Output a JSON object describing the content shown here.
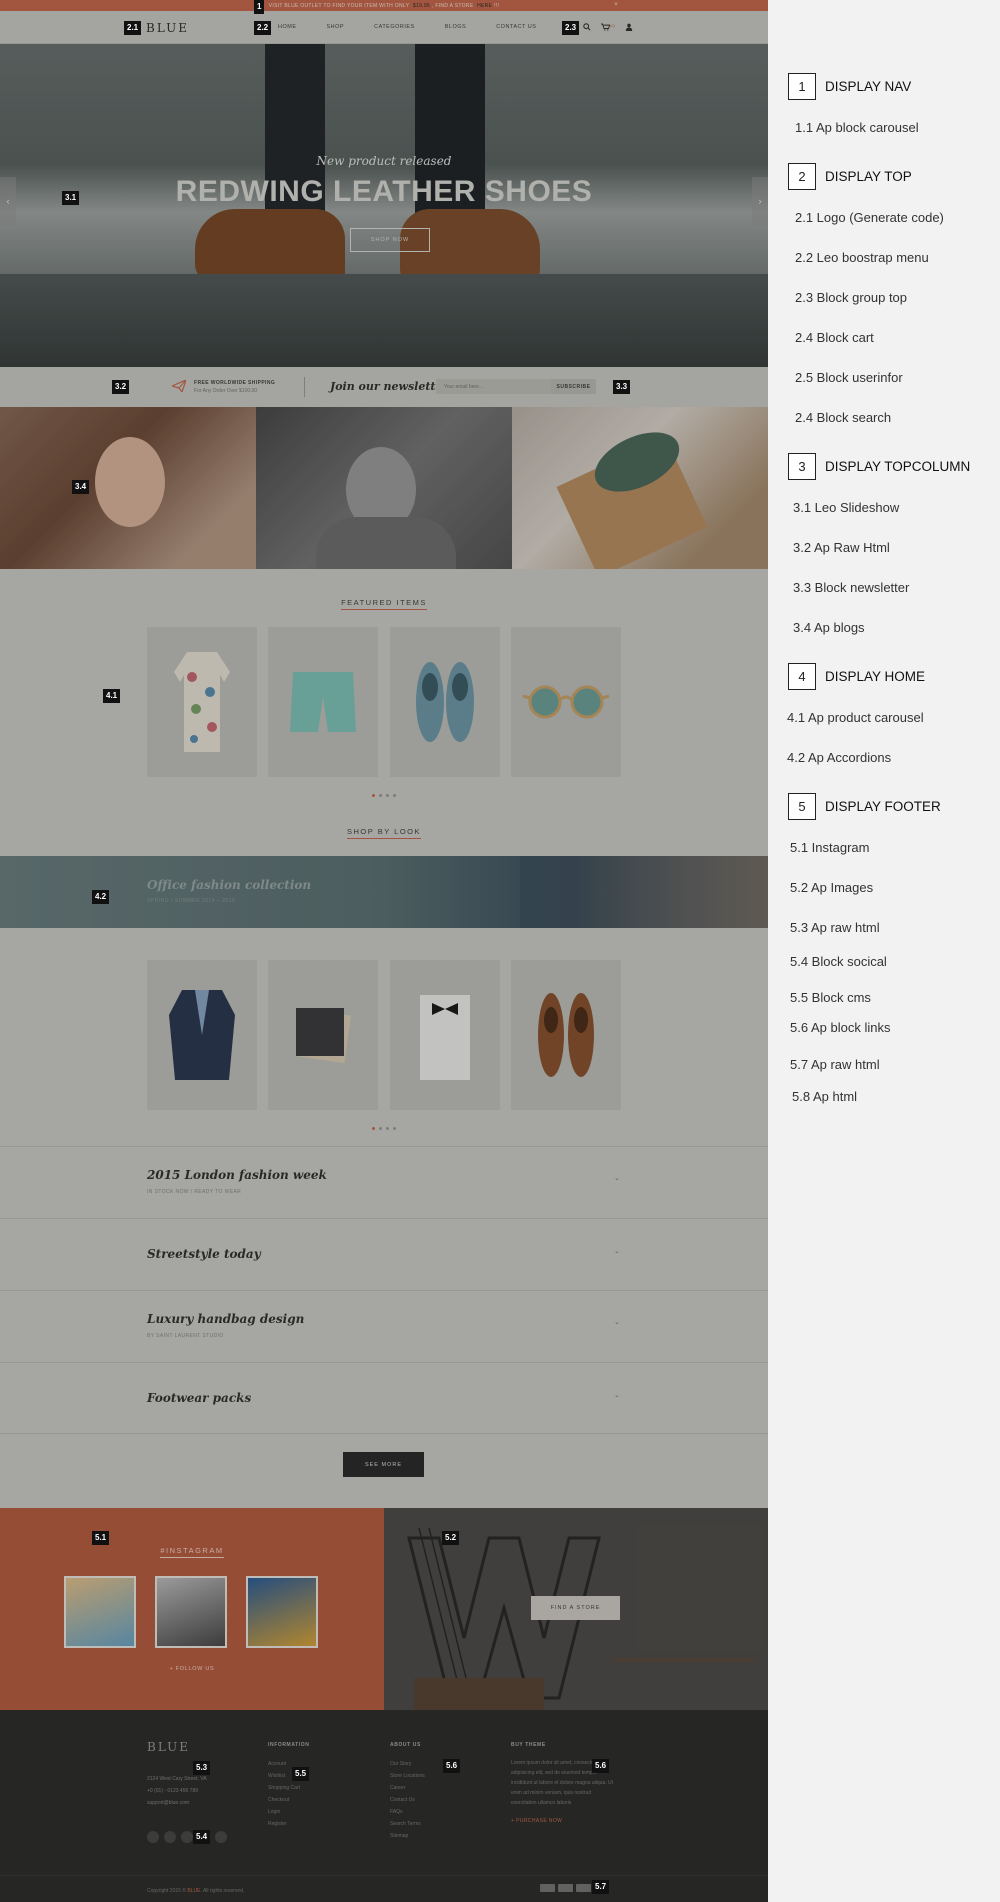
{
  "topbar": {
    "text_before": "VISIT BLUE OUTLET TO FIND YOUR ITEM WITH ONLY",
    "price": "$19.95",
    "text_mid": ", FIND A STORE",
    "link": "HERE",
    "text_after": "!!!",
    "close": "×"
  },
  "header": {
    "logo": "BLUE",
    "menu": [
      "HOME",
      "SHOP",
      "CATEGORIES",
      "BLOGS",
      "CONTACT US"
    ],
    "icons": [
      "search-icon",
      "cart-icon",
      "user-icon"
    ],
    "cart_count": "(0)"
  },
  "hero": {
    "subtitle": "New product released",
    "title": "REDWING LEATHER SHOES",
    "button": "SHOP NOW",
    "prev": "‹",
    "next": "›"
  },
  "shipping": {
    "title": "FREE WORLDWIDE SHIPPING",
    "subtitle": "For Any Order Over $100.00"
  },
  "newsletter": {
    "title": "Join our newsletters",
    "placeholder": "Your email here...",
    "button": "SUBSCRIBE"
  },
  "featured": {
    "title": "FEATURED ITEMS",
    "products": [
      "floral-shirt",
      "mint-shorts",
      "blue-loafers",
      "sunglasses"
    ]
  },
  "shop_by_look": {
    "title": "SHOP BY LOOK",
    "banner_title": "Office fashion collection",
    "banner_sub": "SPRING / SUMMER 2014 – 2015",
    "products": [
      "navy-blazer",
      "pocket-square",
      "white-shirt-bowtie",
      "brown-oxford-shoes"
    ]
  },
  "accordions": [
    {
      "title": "2015 London fashion week",
      "sub": "IN STOCK NOW / READY TO WEAR"
    },
    {
      "title": "Streetstyle today",
      "sub": ""
    },
    {
      "title": "Luxury handbag design",
      "sub": "BY SAINT LAURENT STUDIO"
    },
    {
      "title": "Footwear packs",
      "sub": ""
    }
  ],
  "see_more": "SEE MORE",
  "instagram": {
    "title": "#INSTAGRAM",
    "follow": "+ FOLLOW US"
  },
  "store_button": "FIND A STORE",
  "footer": {
    "logo": "BLUE",
    "address": [
      "2124 West Cary Street, VA",
      "+0 (01) - 0123 456 789",
      "support@blue.com"
    ],
    "information": {
      "title": "INFORMATION",
      "items": [
        "Account",
        "Wishlist",
        "Shopping Cart",
        "Checkout",
        "Login",
        "Register"
      ]
    },
    "about": {
      "title": "ABOUT US",
      "items": [
        "Our Story",
        "Store Locations",
        "Career",
        "Contact Us",
        "FAQs",
        "Search Terms",
        "Sitemap"
      ]
    },
    "buy": {
      "title": "BUY THEME",
      "text": "Lorem ipsum dolor sit amet, consectetur adipisicing elit, sed do eiusmod tempor incididunt ut labore et dolore magna aliqua. Ut enim ad minim veniam, quis nostrud exercitation ullamco laboris",
      "link": "+ PURCHASE NOW"
    },
    "copyright_before": "Copyright 2015 ©",
    "copyright_brand": "BLUE",
    "copyright_after": ". All rights reserved."
  },
  "badges": [
    "1",
    "2.1",
    "2.2",
    "2.3",
    "3.1",
    "3.2",
    "3.3",
    "3.4",
    "4.1",
    "4.2",
    "5.1",
    "5.2",
    "5.3",
    "5.4",
    "5.5",
    "5.6",
    "5.6",
    "5.7"
  ],
  "legend": {
    "sections": [
      {
        "num": "1",
        "title": "DISPLAY NAV",
        "items": [
          "1.1  Ap block carousel"
        ]
      },
      {
        "num": "2",
        "title": "DISPLAY TOP",
        "items": [
          "2.1 Logo (Generate code)",
          "2.2 Leo boostrap menu",
          "2.3 Block group top",
          "2.4 Block cart",
          "2.5 Block userinfor",
          "2.4 Block search"
        ]
      },
      {
        "num": "3",
        "title": "DISPLAY TOPCOLUMN",
        "items": [
          "3.1 Leo Slideshow",
          "3.2 Ap Raw Html",
          "3.3 Block newsletter",
          "3.4 Ap blogs"
        ]
      },
      {
        "num": "4",
        "title": "DISPLAY HOME",
        "items": [
          "4.1 Ap product carousel",
          "4.2 Ap  Accordions"
        ]
      },
      {
        "num": "5",
        "title": "DISPLAY FOOTER",
        "items": [
          "5.1 Instagram",
          "5.2 Ap  Images",
          "5.3 Ap raw html",
          "5.4 Block socical",
          "5.5 Block cms",
          "5.6 Ap block links",
          "5.7 Ap raw html",
          "5.8 Ap html"
        ]
      }
    ]
  },
  "colors": {
    "accent": "#c76a4d",
    "footer": "#2f2f2d",
    "panel": "#f2f2f2"
  }
}
